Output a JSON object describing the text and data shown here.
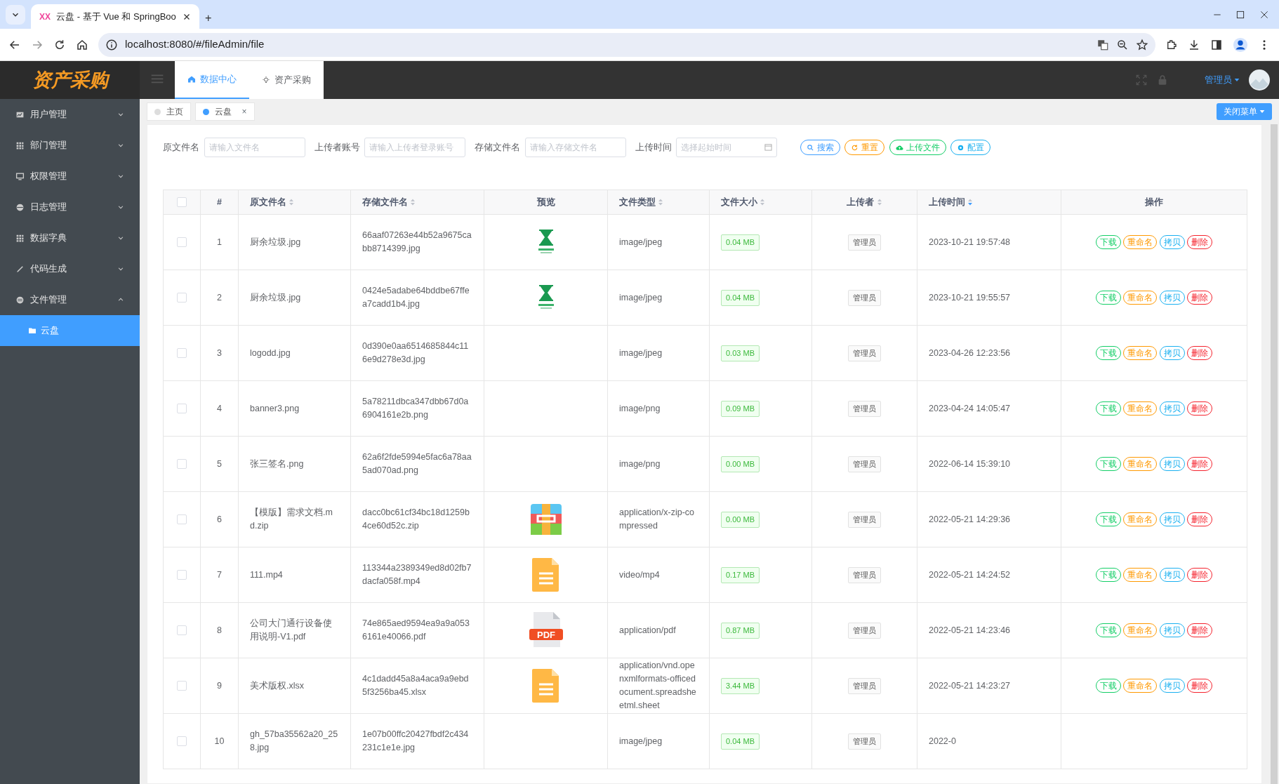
{
  "browser": {
    "tab_icon": "XX",
    "tab_title": "云盘 - 基于 Vue 和 SpringBoo",
    "new_tab": "+",
    "url": "localhost:8080/#/fileAdmin/file"
  },
  "app": {
    "logo": "资产采购",
    "top_tabs": [
      {
        "label": "数据中心",
        "selected": true
      },
      {
        "label": "资产采购",
        "selected": false
      }
    ],
    "user": "管理员"
  },
  "sidebar": {
    "items": [
      {
        "label": "用户管理",
        "expanded": false
      },
      {
        "label": "部门管理",
        "expanded": false
      },
      {
        "label": "权限管理",
        "expanded": false
      },
      {
        "label": "日志管理",
        "expanded": false
      },
      {
        "label": "数据字典",
        "expanded": false
      },
      {
        "label": "代码生成",
        "expanded": false
      },
      {
        "label": "文件管理",
        "expanded": true,
        "children": [
          {
            "label": "云盘",
            "selected": true
          }
        ]
      }
    ]
  },
  "page_tabs": [
    {
      "label": "主页",
      "selected": false
    },
    {
      "label": "云盘",
      "selected": true,
      "close": "×"
    }
  ],
  "close_menu": "关闭菜单",
  "filters": [
    {
      "label": "原文件名",
      "placeholder": "请输入文件名",
      "kind": "text"
    },
    {
      "label": "上传者账号",
      "placeholder": "请输入上传者登录账号",
      "kind": "text"
    },
    {
      "label": "存储文件名",
      "placeholder": "请输入存储文件名",
      "kind": "text"
    },
    {
      "label": "上传时间",
      "placeholder": "选择起始时间",
      "kind": "date"
    }
  ],
  "toolbar": [
    {
      "label": "搜索",
      "kind": "search",
      "color": "#409eff"
    },
    {
      "label": "重置",
      "kind": "reset",
      "color": "#ff9900"
    },
    {
      "label": "上传文件",
      "kind": "upload",
      "color": "#13ce66"
    },
    {
      "label": "配置",
      "kind": "config",
      "color": "#1ab0f0"
    }
  ],
  "table": {
    "all_checked": false,
    "columns": [
      {
        "label": "#"
      },
      {
        "label": "原文件名",
        "sortable": true,
        "sorted": false
      },
      {
        "label": "存储文件名",
        "sortable": true,
        "sorted": false
      },
      {
        "label": "预览"
      },
      {
        "label": "文件类型",
        "sortable": true,
        "sorted": false
      },
      {
        "label": "文件大小",
        "sortable": true,
        "sorted": false
      },
      {
        "label": "上传者",
        "sortable": true,
        "sorted": false
      },
      {
        "label": "上传时间",
        "sortable": true,
        "sorted": true
      },
      {
        "label": "操作"
      }
    ],
    "rows": [
      {
        "checked": false,
        "index": "1",
        "name": "厨余垃圾.jpg",
        "stored": "66aaf07263e44b52a9675cabb8714399.jpg",
        "type": "image/jpeg",
        "size": "0.04 MB",
        "uploader": "管理员",
        "time": "2023-10-21 19:57:48",
        "actions": [
          {
            "label": "下载",
            "color": "#13ce66"
          },
          {
            "label": "重命名",
            "color": "#ff9900"
          },
          {
            "label": "拷贝",
            "color": "#1ab0f0"
          },
          {
            "label": "删除",
            "color": "#f5222d"
          }
        ]
      },
      {
        "checked": false,
        "index": "2",
        "name": "厨余垃圾.jpg",
        "stored": "0424e5adabe64bddbe67ffea7cadd1b4.jpg",
        "type": "image/jpeg",
        "size": "0.04 MB",
        "uploader": "管理员",
        "time": "2023-10-21 19:55:57",
        "actions": [
          {
            "label": "下载",
            "color": "#13ce66"
          },
          {
            "label": "重命名",
            "color": "#ff9900"
          },
          {
            "label": "拷贝",
            "color": "#1ab0f0"
          },
          {
            "label": "删除",
            "color": "#f5222d"
          }
        ]
      },
      {
        "checked": false,
        "index": "3",
        "name": "logodd.jpg",
        "stored": "0d390e0aa6514685844c116e9d278e3d.jpg",
        "type": "image/jpeg",
        "size": "0.03 MB",
        "uploader": "管理员",
        "time": "2023-04-26 12:23:56",
        "actions": [
          {
            "label": "下载",
            "color": "#13ce66"
          },
          {
            "label": "重命名",
            "color": "#ff9900"
          },
          {
            "label": "拷贝",
            "color": "#1ab0f0"
          },
          {
            "label": "删除",
            "color": "#f5222d"
          }
        ]
      },
      {
        "checked": false,
        "index": "4",
        "name": "banner3.png",
        "stored": "5a78211dbca347dbb67d0a6904161e2b.png",
        "type": "image/png",
        "size": "0.09 MB",
        "uploader": "管理员",
        "time": "2023-04-24 14:05:47",
        "actions": [
          {
            "label": "下载",
            "color": "#13ce66"
          },
          {
            "label": "重命名",
            "color": "#ff9900"
          },
          {
            "label": "拷贝",
            "color": "#1ab0f0"
          },
          {
            "label": "删除",
            "color": "#f5222d"
          }
        ]
      },
      {
        "checked": false,
        "index": "5",
        "name": "张三签名.png",
        "stored": "62a6f2fde5994e5fac6a78aa5ad070ad.png",
        "type": "image/png",
        "size": "0.00 MB",
        "uploader": "管理员",
        "time": "2022-06-14 15:39:10",
        "actions": [
          {
            "label": "下载",
            "color": "#13ce66"
          },
          {
            "label": "重命名",
            "color": "#ff9900"
          },
          {
            "label": "拷贝",
            "color": "#1ab0f0"
          },
          {
            "label": "删除",
            "color": "#f5222d"
          }
        ]
      },
      {
        "checked": false,
        "index": "6",
        "name": "【模版】需求文档.md.zip",
        "stored": "dacc0bc61cf34bc18d1259b4ce60d52c.zip",
        "preview": {
          "kind": "zip"
        },
        "type": "application/x-zip-compressed",
        "size": "0.00 MB",
        "uploader": "管理员",
        "time": "2022-05-21 14:29:36",
        "actions": [
          {
            "label": "下载",
            "color": "#13ce66"
          },
          {
            "label": "重命名",
            "color": "#ff9900"
          },
          {
            "label": "拷贝",
            "color": "#1ab0f0"
          },
          {
            "label": "删除",
            "color": "#f5222d"
          }
        ]
      },
      {
        "checked": false,
        "index": "7",
        "name": "111.mp4",
        "stored": "113344a2389349ed8d02fb7dacfa058f.mp4",
        "preview": {
          "kind": "doc"
        },
        "type": "video/mp4",
        "size": "0.17 MB",
        "uploader": "管理员",
        "time": "2022-05-21 14:24:52",
        "actions": [
          {
            "label": "下载",
            "color": "#13ce66"
          },
          {
            "label": "重命名",
            "color": "#ff9900"
          },
          {
            "label": "拷贝",
            "color": "#1ab0f0"
          },
          {
            "label": "删除",
            "color": "#f5222d"
          }
        ]
      },
      {
        "checked": false,
        "index": "8",
        "name": "公司大门通行设备使用说明-V1.pdf",
        "stored": "74e865aed9594ea9a9a0536161e40066.pdf",
        "preview": {
          "kind": "pdf",
          "label": "PDF"
        },
        "type": "application/pdf",
        "size": "0.87 MB",
        "uploader": "管理员",
        "time": "2022-05-21 14:23:46",
        "actions": [
          {
            "label": "下载",
            "color": "#13ce66"
          },
          {
            "label": "重命名",
            "color": "#ff9900"
          },
          {
            "label": "拷贝",
            "color": "#1ab0f0"
          },
          {
            "label": "删除",
            "color": "#f5222d"
          }
        ]
      },
      {
        "checked": false,
        "index": "9",
        "name": "美术版权.xlsx",
        "stored": "4c1dadd45a8a4aca9a9ebd5f3256ba45.xlsx",
        "preview": {
          "kind": "doc"
        },
        "type": "application/vnd.openxmlformats-officedocument.spreadsheetml.sheet",
        "size": "3.44 MB",
        "uploader": "管理员",
        "time": "2022-05-21 14:23:27",
        "actions": [
          {
            "label": "下载",
            "color": "#13ce66"
          },
          {
            "label": "重命名",
            "color": "#ff9900"
          },
          {
            "label": "拷贝",
            "color": "#1ab0f0"
          },
          {
            "label": "删除",
            "color": "#f5222d"
          }
        ]
      },
      {
        "checked": false,
        "index": "10",
        "name": "gh_57ba35562a20_258.jpg",
        "stored": "1e07b00ffc20427fbdf2c434231c1e1e.jpg",
        "type": "image/jpeg",
        "size": "0.04 MB",
        "uploader": "管理员",
        "time": "2022-0"
      }
    ]
  }
}
